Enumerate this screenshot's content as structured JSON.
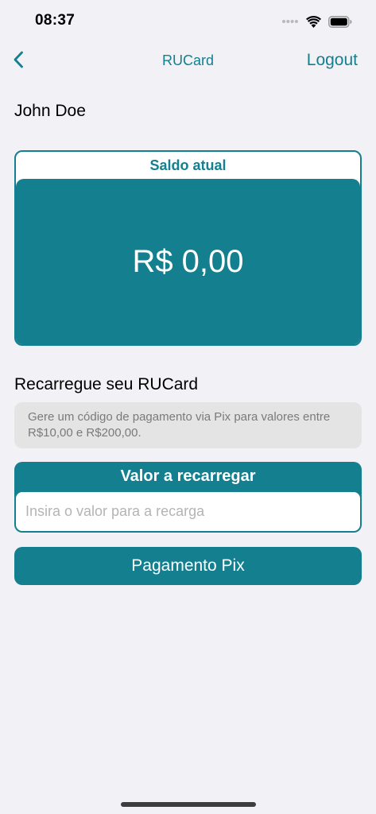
{
  "status_bar": {
    "time": "08:37",
    "icons": [
      "signal-dots-icon",
      "wifi-icon",
      "battery-icon"
    ]
  },
  "nav": {
    "back_icon": "chevron-left-icon",
    "title": "RUCard",
    "logout_label": "Logout"
  },
  "user": {
    "name": "John Doe"
  },
  "balance": {
    "label": "Saldo atual",
    "value": "R$ 0,00"
  },
  "recharge": {
    "title": "Recarregue seu RUCard",
    "info": "Gere um código de pagamento via Pix para valores entre R$10,00 e R$200,00.",
    "amount_label": "Valor a recarregar",
    "amount_value": "",
    "amount_placeholder": "Insira o valor para a recarga",
    "pix_button_label": "Pagamento Pix"
  },
  "colors": {
    "accent": "#137f8f",
    "background": "#f2f1f6",
    "info_background": "#e4e4e4"
  }
}
